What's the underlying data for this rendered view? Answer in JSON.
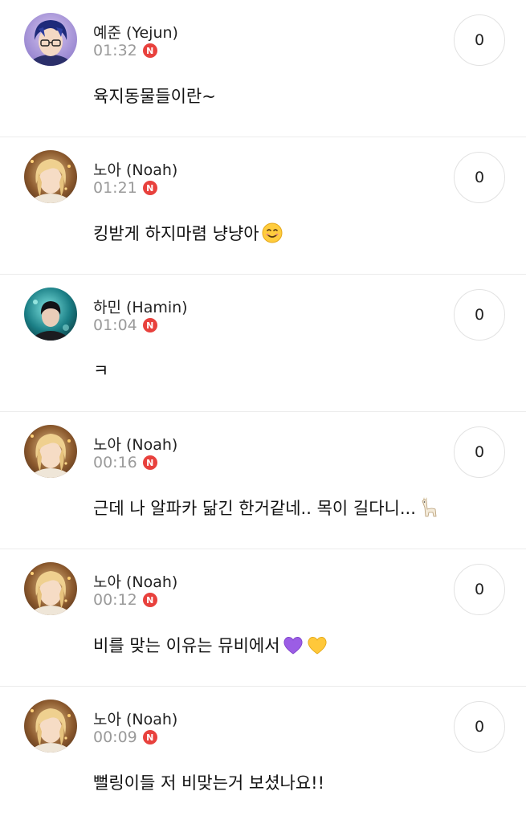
{
  "comments": [
    {
      "author": "예준 (Yejun)",
      "time": "01:32",
      "badge": "N",
      "likes": "0",
      "text": "육지동물들이란~",
      "emoji": [],
      "avatar_icon": "blue-hair-glasses-avatar"
    },
    {
      "author": "노아 (Noah)",
      "time": "01:21",
      "badge": "N",
      "likes": "0",
      "text": "킹받게 하지마렴 냥냥아",
      "emoji": [
        "smiling-face-emoji"
      ],
      "avatar_icon": "blonde-hair-avatar"
    },
    {
      "author": "하민 (Hamin)",
      "time": "01:04",
      "badge": "N",
      "likes": "0",
      "text": "ㅋ",
      "emoji": [],
      "avatar_icon": "dark-hair-teal-background-avatar"
    },
    {
      "author": "노아 (Noah)",
      "time": "00:16",
      "badge": "N",
      "likes": "0",
      "text": "근데 나 알파카 닮긴 한거같네.. 목이 길다니...",
      "emoji": [
        "llama-emoji"
      ],
      "avatar_icon": "blonde-hair-avatar"
    },
    {
      "author": "노아 (Noah)",
      "time": "00:12",
      "badge": "N",
      "likes": "0",
      "text": "비를 맞는 이유는 뮤비에서",
      "emoji": [
        "purple-heart-emoji",
        "yellow-heart-emoji"
      ],
      "avatar_icon": "blonde-hair-avatar"
    },
    {
      "author": "노아 (Noah)",
      "time": "00:09",
      "badge": "N",
      "likes": "0",
      "text": "뻘링이들 저 비맞는거 보셨나요!!",
      "emoji": [],
      "avatar_icon": "blonde-hair-avatar"
    }
  ],
  "colors": {
    "badge": "#e8413d",
    "time": "#9a9a9a",
    "divider": "#ececec"
  }
}
